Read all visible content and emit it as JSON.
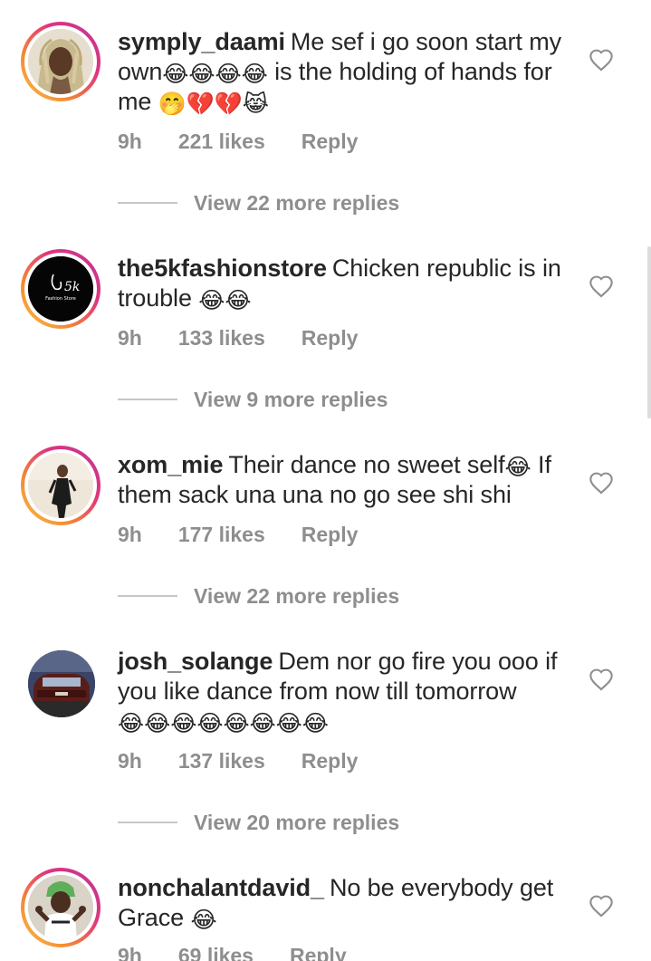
{
  "comments": [
    {
      "username": "symply_daami",
      "text_1": "Me sef i go soon start my own",
      "text_2": " is the holding of hands for me ",
      "emoji_1": "😂😂😂😂",
      "emoji_2": "🤭💔💔😹",
      "time": "9h",
      "likes": "221 likes",
      "reply": "Reply",
      "view_replies": "View 22 more replies"
    },
    {
      "username": "the5kfashionstore",
      "text_1": "Chicken republic is in trouble ",
      "emoji_1": "😂😂",
      "avatar_logo_text": "5k",
      "avatar_logo_subtext": "Fashion Store",
      "time": "9h",
      "likes": "133 likes",
      "reply": "Reply",
      "view_replies": "View 9 more replies"
    },
    {
      "username": "xom_mie",
      "text_1": "Their dance no sweet self",
      "emoji_1": "😂",
      "text_2": " If them sack una una no go see shi shi",
      "time": "9h",
      "likes": "177 likes",
      "reply": "Reply",
      "view_replies": "View 22 more replies"
    },
    {
      "username": "josh_solange",
      "text_1": "Dem nor go fire you ooo if you like dance from now till tomorrow ",
      "emoji_1": "😂😂😂😂😂😂😂😂",
      "time": "9h",
      "likes": "137 likes",
      "reply": "Reply",
      "view_replies": "View 20 more replies"
    },
    {
      "username": "nonchalantdavid_",
      "text_1": "No be everybody get Grace ",
      "emoji_1": "😂",
      "time": "9h",
      "likes": "69 likes",
      "reply": "Reply"
    }
  ],
  "icons": {
    "like": "heart-outline-icon"
  },
  "colors": {
    "text": "#262626",
    "muted": "#8e8e8e",
    "story_ring_start": "#f7c24a",
    "story_ring_end": "#b9389b"
  }
}
